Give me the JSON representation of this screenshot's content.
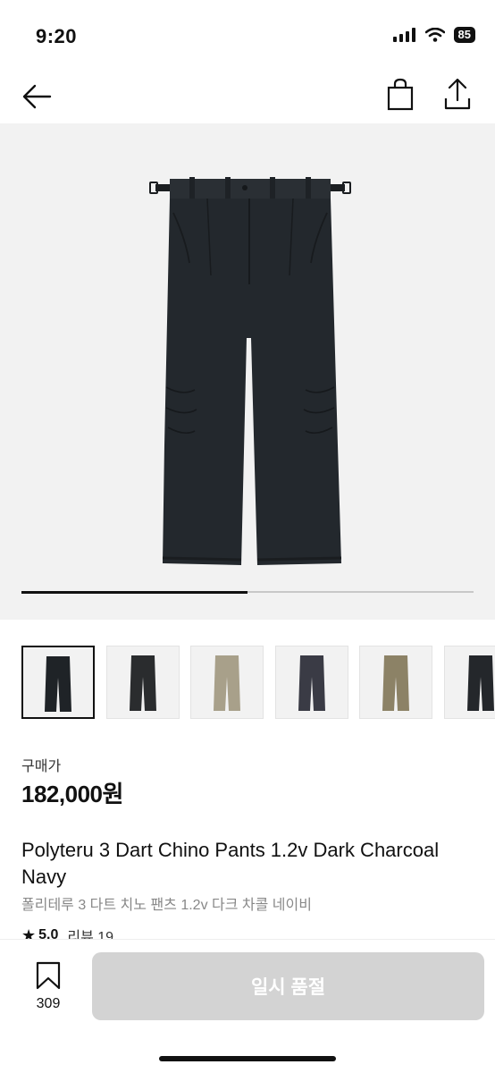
{
  "status_bar": {
    "time": "9:20",
    "battery": "85",
    "icons": [
      "signal-icon",
      "wifi-icon",
      "battery-icon"
    ]
  },
  "nav": {
    "icons": [
      "back-arrow-icon",
      "shopping-bag-icon",
      "share-icon"
    ]
  },
  "gallery": {
    "progress_fraction": 0.5,
    "thumbnail_colors": [
      "#1f2327",
      "#2a2c2e",
      "#a8a08a",
      "#3a3b45",
      "#8c8266",
      "#24272b"
    ]
  },
  "product": {
    "price_label": "구매가",
    "price": "182,000원",
    "title_en": "Polyteru 3 Dart Chino Pants 1.2v Dark Charcoal Navy",
    "title_ko": "폴리테루 3 다트 치노 팬츠 1.2v 다크 차콜 네이비",
    "rating": "5.0",
    "review_text": "리뷰 19"
  },
  "bottom_bar": {
    "wishlist_count": "309",
    "button_label": "일시 품절"
  },
  "colors": {
    "pants": "#23282d",
    "hero_bg": "#f2f2f2",
    "button_disabled": "#d3d3d3"
  }
}
